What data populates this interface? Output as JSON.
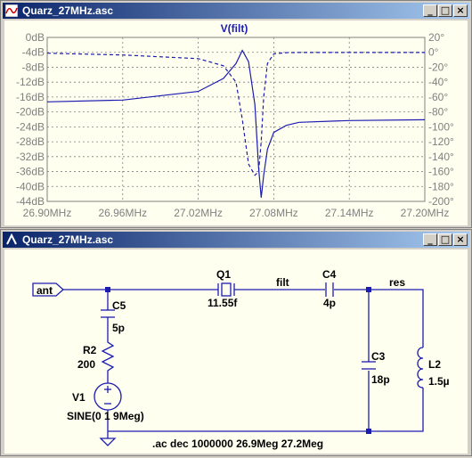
{
  "plot_window": {
    "title": "Quarz_27MHz.asc",
    "trace_label": "V(filt)",
    "left_axis_ticks": [
      "0dB",
      "-4dB",
      "-8dB",
      "-12dB",
      "-16dB",
      "-20dB",
      "-24dB",
      "-28dB",
      "-32dB",
      "-36dB",
      "-40dB",
      "-44dB"
    ],
    "right_axis_ticks": [
      "20°",
      "0°",
      "-20°",
      "-40°",
      "-60°",
      "-80°",
      "-100°",
      "-120°",
      "-140°",
      "-160°",
      "-180°",
      "-200°"
    ],
    "x_axis_ticks": [
      "26.90MHz",
      "26.96MHz",
      "27.02MHz",
      "27.08MHz",
      "27.14MHz",
      "27.20MHz"
    ],
    "colors": {
      "plot_bg": "#fffff0",
      "trace": "#1c1cb0",
      "axis_text": "#808080",
      "title_text": "#1c1cb0"
    }
  },
  "schematic_window": {
    "title": "Quarz_27MHz.asc",
    "port_label": "ant",
    "net_labels": {
      "filt": "filt",
      "res": "res"
    },
    "components": {
      "Q1": {
        "name": "Q1",
        "value": "11.55f"
      },
      "C4": {
        "name": "C4",
        "value": "4p"
      },
      "C5": {
        "name": "C5",
        "value": "5p"
      },
      "R2": {
        "name": "R2",
        "value": "200"
      },
      "V1": {
        "name": "V1",
        "value": "SINE(0 1 9Meg)"
      },
      "C3": {
        "name": "C3",
        "value": "18p"
      },
      "L2": {
        "name": "L2",
        "value": "1.5µ"
      }
    },
    "directive": ".ac dec 1000000 26.9Meg 27.2Meg",
    "colors": {
      "bg": "#fffff0",
      "wire": "#1c1cb0"
    }
  },
  "chart_data": {
    "type": "line",
    "title": "V(filt)",
    "x": [
      26.9,
      26.96,
      27.02,
      27.04,
      27.05,
      27.055,
      27.06,
      27.065,
      27.068,
      27.07,
      27.072,
      27.075,
      27.08,
      27.09,
      27.1,
      27.14,
      27.2
    ],
    "xlabel": "",
    "x_ticks": [
      "26.90MHz",
      "26.96MHz",
      "27.02MHz",
      "27.08MHz",
      "27.14MHz",
      "27.20MHz"
    ],
    "xlim": [
      26.9,
      27.2
    ],
    "ylim_left": [
      -44,
      0
    ],
    "ylim_right": [
      -200,
      20
    ],
    "grid": true,
    "series": [
      {
        "name": "",
        "axis": "left",
        "style": "solid",
        "values": [
          -17.3,
          -16.8,
          -14.5,
          -11.0,
          -7.0,
          -3.5,
          -6.5,
          -18.0,
          -35.0,
          -43.0,
          -37.0,
          -30.0,
          -25.5,
          -23.6,
          -22.8,
          -22.3,
          -22.1
        ]
      },
      {
        "name": "",
        "axis": "right",
        "style": "dashed",
        "values": [
          -1.2,
          -3.5,
          -8.5,
          -18.0,
          -40.0,
          -90.0,
          -150.0,
          -165.0,
          -160.0,
          -120.0,
          -60.0,
          -15.0,
          -2.0,
          -0.5,
          -0.2,
          -0.2,
          -0.2
        ]
      }
    ]
  }
}
